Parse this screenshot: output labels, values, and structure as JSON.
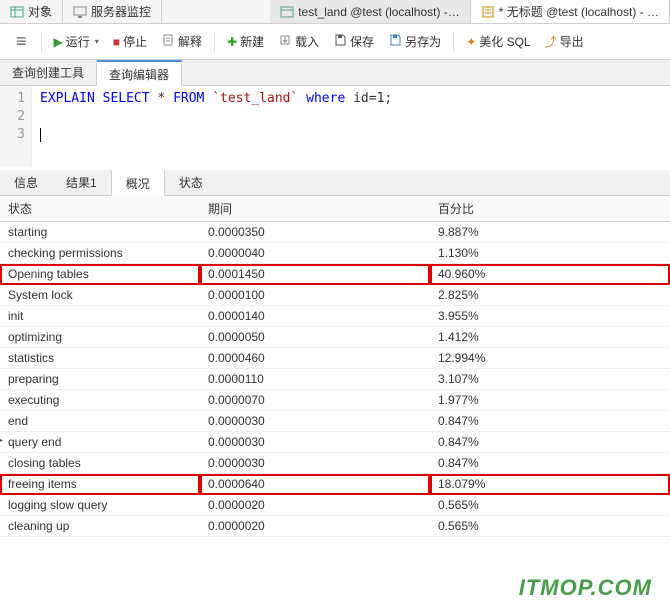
{
  "top_tabs": {
    "objects": "对象",
    "monitor": "服务器监控",
    "test_land": "test_land @test (localhost) -…",
    "untitled": "* 无标题 @test (localhost) - …"
  },
  "toolbar": {
    "run": "运行",
    "stop": "停止",
    "explain": "解释",
    "new": "新建",
    "load": "载入",
    "save": "保存",
    "save_as": "另存为",
    "beautify": "美化 SQL",
    "export": "导出"
  },
  "query_tabs": {
    "builder": "查询创建工具",
    "editor": "查询编辑器"
  },
  "editor": {
    "lines": [
      "1",
      "2",
      "3"
    ],
    "kw_explain": "EXPLAIN",
    "kw_select": "SELECT",
    "star": " * ",
    "kw_from": "FROM",
    "backtick_table": " `test_land` ",
    "kw_where": "where",
    "rest": " id=1;"
  },
  "result_tabs": {
    "info": "信息",
    "result1": "结果1",
    "profile": "概况",
    "status": "状态"
  },
  "table": {
    "headers": {
      "status": "状态",
      "time": "期间",
      "pct": "百分比"
    },
    "rows": [
      {
        "status": "starting",
        "time": "0.0000350",
        "pct": "9.887%",
        "hl": false
      },
      {
        "status": "checking permissions",
        "time": "0.0000040",
        "pct": "1.130%",
        "hl": false
      },
      {
        "status": "Opening tables",
        "time": "0.0001450",
        "pct": "40.960%",
        "hl": true
      },
      {
        "status": "System lock",
        "time": "0.0000100",
        "pct": "2.825%",
        "hl": false
      },
      {
        "status": "init",
        "time": "0.0000140",
        "pct": "3.955%",
        "hl": false
      },
      {
        "status": "optimizing",
        "time": "0.0000050",
        "pct": "1.412%",
        "hl": false
      },
      {
        "status": "statistics",
        "time": "0.0000460",
        "pct": "12.994%",
        "hl": false
      },
      {
        "status": "preparing",
        "time": "0.0000110",
        "pct": "3.107%",
        "hl": false
      },
      {
        "status": "executing",
        "time": "0.0000070",
        "pct": "1.977%",
        "hl": false
      },
      {
        "status": "end",
        "time": "0.0000030",
        "pct": "0.847%",
        "hl": false
      },
      {
        "status": "query end",
        "time": "0.0000030",
        "pct": "0.847%",
        "hl": false,
        "arrow": true
      },
      {
        "status": "closing tables",
        "time": "0.0000030",
        "pct": "0.847%",
        "hl": false
      },
      {
        "status": "freeing items",
        "time": "0.0000640",
        "pct": "18.079%",
        "hl": true
      },
      {
        "status": "logging slow query",
        "time": "0.0000020",
        "pct": "0.565%",
        "hl": false
      },
      {
        "status": "cleaning up",
        "time": "0.0000020",
        "pct": "0.565%",
        "hl": false
      }
    ]
  },
  "watermark": "ITMOP.COM"
}
